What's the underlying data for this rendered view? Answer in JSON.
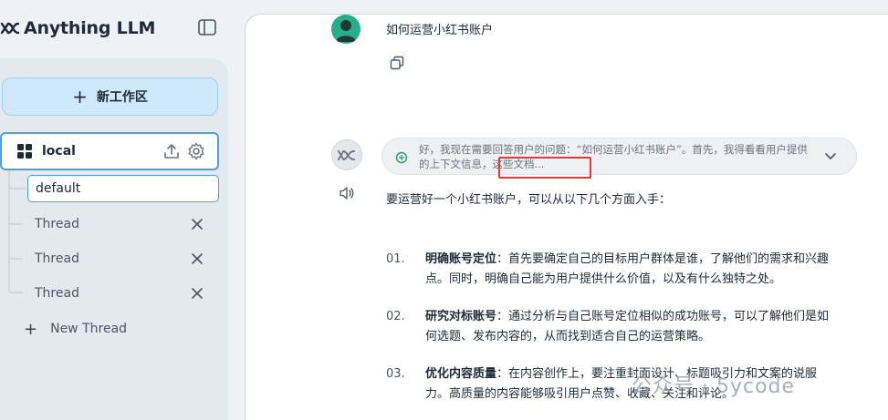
{
  "sidebar": {
    "brand": "Anything LLM",
    "new_workspace_label": "新工作区",
    "workspace_name": "local",
    "thread_input_value": "default",
    "threads": [
      {
        "label": "Thread"
      },
      {
        "label": "Thread"
      },
      {
        "label": "Thread"
      }
    ],
    "new_thread_label": "New Thread"
  },
  "chat": {
    "user_message": "如何运营小红书账户",
    "thinking_text": "好，我现在需要回答用户的问题：“如何运营小红书账户”。首先，我得看看用户提供的上下文信息，这些文档...",
    "intro": "要运营好一个小红书账户，可以从以下几个方面入手：",
    "items": [
      {
        "num": "01.",
        "title": "明确账号定位",
        "text": "：首先要确定自己的目标用户群体是谁，了解他们的需求和兴趣点。同时，明确自己能为用户提供什么价值，以及有什么独特之处。"
      },
      {
        "num": "02.",
        "title": "研究对标账号",
        "text": "：通过分析与自己账号定位相似的成功账号，可以了解他们是如何选题、发布内容的，从而找到适合自己的运营策略。"
      },
      {
        "num": "03.",
        "title": "优化内容质量",
        "text": "：在内容创作上，要注重封面设计、标题吸引力和文案的说服力。高质量的内容能够吸引用户点赞、收藏、关注和评论。"
      }
    ]
  },
  "watermark": "公众号 · 5ycode",
  "colors": {
    "accent": "#4e9de6",
    "new_workspace_bg": "#cfe8fb",
    "highlight": "#e53935",
    "avatar": "#27ae8a"
  },
  "icons": [
    "logo-icon",
    "sidebar-toggle-icon",
    "plus-icon",
    "grid-icon",
    "upload-icon",
    "gear-icon",
    "close-icon",
    "user-avatar-icon",
    "copy-icon",
    "ai-avatar-icon",
    "leaf-icon",
    "chevron-down-icon",
    "speaker-icon"
  ]
}
